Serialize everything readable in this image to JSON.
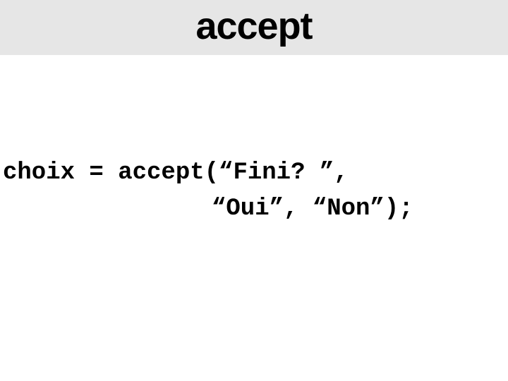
{
  "title": "accept",
  "code": {
    "line1": "choix = accept(“Fini? ”,",
    "line2": "“Oui”, “Non”);"
  }
}
